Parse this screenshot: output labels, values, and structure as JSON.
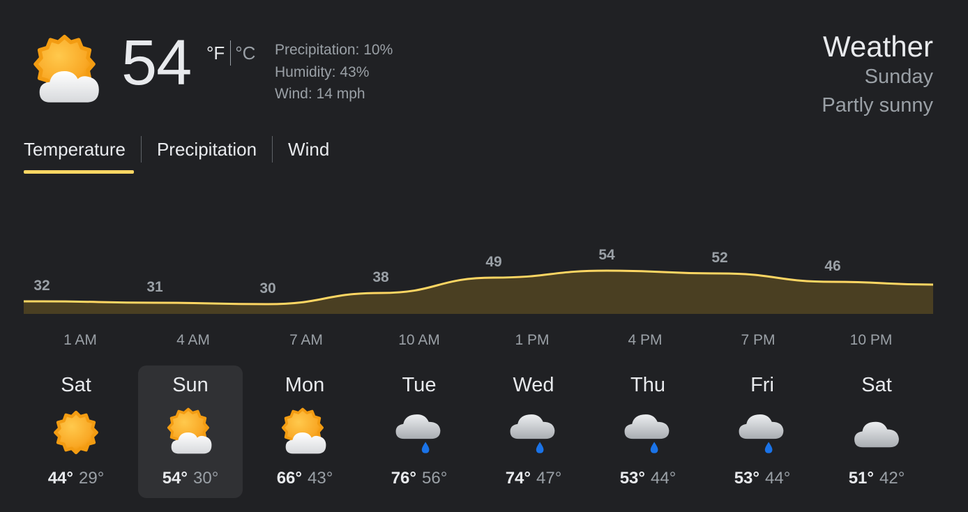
{
  "current": {
    "temp": "54",
    "unit_f": "°F",
    "unit_c": "°C",
    "condition_icon": "partly-sunny-icon",
    "precipitation": "Precipitation: 10%",
    "humidity": "Humidity: 43%",
    "wind": "Wind: 14 mph"
  },
  "header": {
    "title": "Weather",
    "day": "Sunday",
    "condition": "Partly sunny"
  },
  "tabs": [
    {
      "label": "Temperature",
      "active": true
    },
    {
      "label": "Precipitation",
      "active": false
    },
    {
      "label": "Wind",
      "active": false
    }
  ],
  "chart_data": {
    "type": "area",
    "x": [
      "1 AM",
      "4 AM",
      "7 AM",
      "10 AM",
      "1 PM",
      "4 PM",
      "7 PM",
      "10 PM"
    ],
    "values": [
      32,
      31,
      30,
      38,
      49,
      54,
      52,
      46
    ],
    "labels": [
      "32",
      "31",
      "30",
      "38",
      "49",
      "54",
      "52",
      "46"
    ],
    "line_color": "#fdd663",
    "fill_color": "#4a3f22"
  },
  "days": [
    {
      "name": "Sat",
      "icon": "sunny-icon",
      "hi": "44°",
      "lo": "29°",
      "selected": false
    },
    {
      "name": "Sun",
      "icon": "partly-sunny-icon",
      "hi": "54°",
      "lo": "30°",
      "selected": true
    },
    {
      "name": "Mon",
      "icon": "partly-sunny-icon",
      "hi": "66°",
      "lo": "43°",
      "selected": false
    },
    {
      "name": "Tue",
      "icon": "rain-icon",
      "hi": "76°",
      "lo": "56°",
      "selected": false
    },
    {
      "name": "Wed",
      "icon": "rain-icon",
      "hi": "74°",
      "lo": "47°",
      "selected": false
    },
    {
      "name": "Thu",
      "icon": "rain-icon",
      "hi": "53°",
      "lo": "44°",
      "selected": false
    },
    {
      "name": "Fri",
      "icon": "rain-icon",
      "hi": "53°",
      "lo": "44°",
      "selected": false
    },
    {
      "name": "Sat",
      "icon": "cloudy-icon",
      "hi": "51°",
      "lo": "42°",
      "selected": false
    }
  ]
}
